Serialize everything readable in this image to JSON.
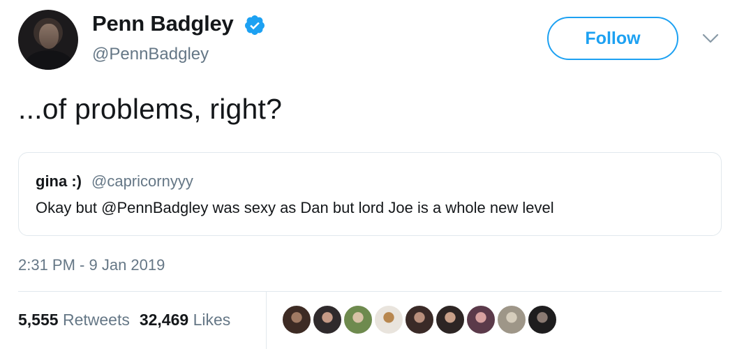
{
  "author": {
    "display_name": "Penn Badgley",
    "handle": "@PennBadgley",
    "verified": true
  },
  "follow_label": "Follow",
  "tweet": {
    "text": "...of problems, right?",
    "timestamp": "2:31 PM - 9 Jan 2019"
  },
  "quoted": {
    "name": "gina :)",
    "handle": "@capricornyyy",
    "text": "Okay but @PennBadgley was sexy as Dan but lord Joe is a whole new level"
  },
  "stats": {
    "retweets_count": "5,555",
    "retweets_label": "Retweets",
    "likes_count": "32,469",
    "likes_label": "Likes"
  },
  "colors": {
    "accent": "#1da1f2",
    "secondary_text": "#657786",
    "border": "#e1e8ed"
  },
  "icons": [
    "verified-badge-icon",
    "chevron-down-icon"
  ],
  "liker_avatars": [
    {
      "bg": "#3d2b24",
      "fg": "#a07a63"
    },
    {
      "bg": "#2f2a2c",
      "fg": "#c59a87"
    },
    {
      "bg": "#6e8a4e",
      "fg": "#d8c2a6"
    },
    {
      "bg": "#e9e4dd",
      "fg": "#b8874f"
    },
    {
      "bg": "#3a2a27",
      "fg": "#b98f7c"
    },
    {
      "bg": "#2d2524",
      "fg": "#c9a089"
    },
    {
      "bg": "#5b3a4a",
      "fg": "#d7a1a0"
    },
    {
      "bg": "#9e9688",
      "fg": "#d6cdbc"
    },
    {
      "bg": "#1e1d1e",
      "fg": "#8a7a72"
    }
  ]
}
